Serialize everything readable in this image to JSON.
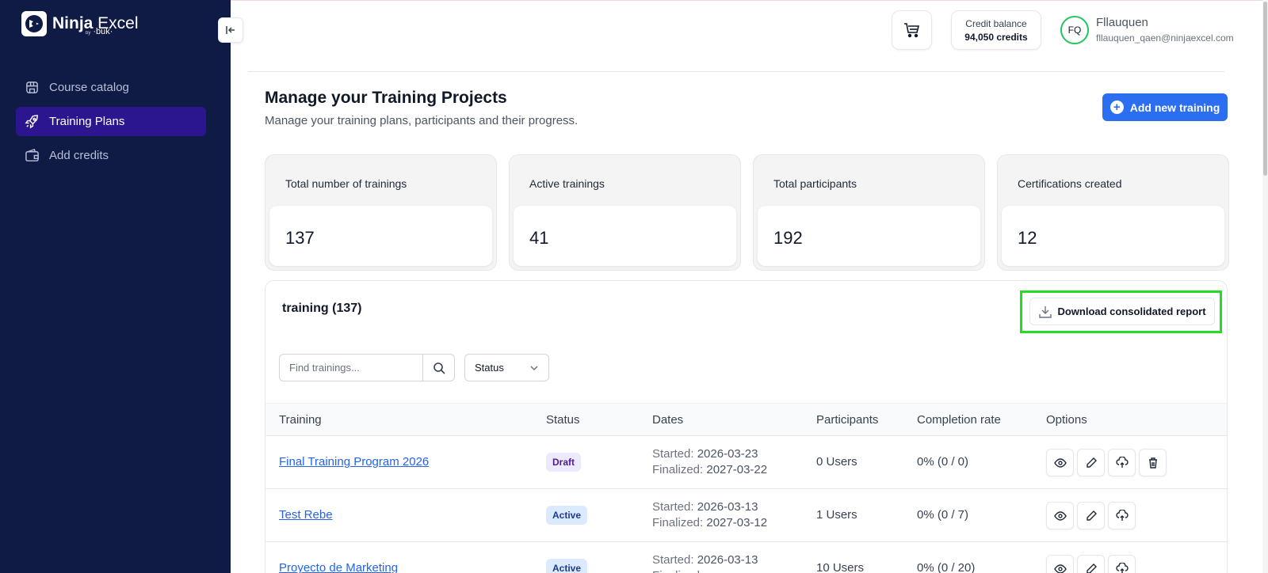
{
  "app": {
    "brand_name_bold": "Ninja",
    "brand_name_light": " Excel",
    "brand_by": "by",
    "brand_sub": "·buk·"
  },
  "sidebar": {
    "items": [
      {
        "label": "Course catalog",
        "icon": "store-icon",
        "active": false
      },
      {
        "label": "Training Plans",
        "icon": "rocket-icon",
        "active": true
      },
      {
        "label": "Add credits",
        "icon": "wallet-icon",
        "active": false
      }
    ]
  },
  "header": {
    "credit_label": "Credit balance",
    "credit_value": "94,050 credits",
    "avatar_initials": "FQ",
    "user_name": "Fllauquen",
    "user_email": "fllauquen_qaen@ninjaexcel.com"
  },
  "page": {
    "title": "Manage your Training Projects",
    "subtitle": "Manage your training plans, participants and their progress.",
    "add_button": "Add new training"
  },
  "stats": [
    {
      "label": "Total number of trainings",
      "value": "137"
    },
    {
      "label": "Active trainings",
      "value": "41"
    },
    {
      "label": "Total participants",
      "value": "192"
    },
    {
      "label": "Certifications created",
      "value": "12"
    }
  ],
  "trainings": {
    "title": "training (137)",
    "download_button": "Download consolidated report",
    "search_placeholder": "Find trainings...",
    "search_value": "",
    "status_filter": "Status",
    "columns": [
      "Training",
      "Status",
      "Dates",
      "Participants",
      "Completion rate",
      "Options"
    ],
    "started_label": "Started:",
    "finalized_label": "Finalized:",
    "rows": [
      {
        "name": "Final Training Program 2026",
        "status": "Draft",
        "started": "2026-03-23",
        "finalized": "2027-03-22",
        "participants": "0 Users",
        "completion": "0% (0 / 0)"
      },
      {
        "name": "Test Rebe",
        "status": "Active",
        "started": "2026-03-13",
        "finalized": "2027-03-12",
        "participants": "1 Users",
        "completion": "0% (0 / 7)"
      },
      {
        "name": "Proyecto de Marketing",
        "status": "Active",
        "started": "2026-03-13",
        "finalized": "",
        "participants": "10 Users",
        "completion": "0% (0 / 20)"
      }
    ]
  },
  "colors": {
    "sidebar_bg": "#0f1a45",
    "active_nav": "#2b1690",
    "primary": "#2b6ff0",
    "highlight": "#22dd22"
  }
}
